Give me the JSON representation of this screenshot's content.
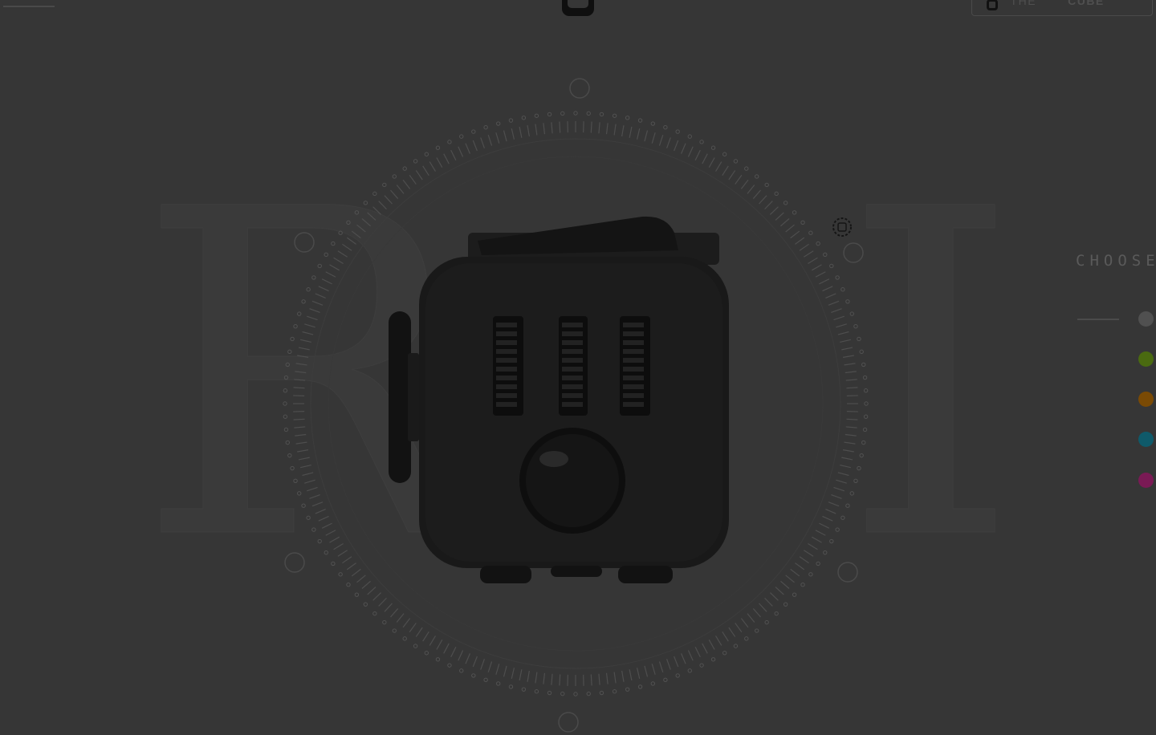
{
  "header": {
    "buy_prefix": "BUY THE",
    "buy_strong": "FIDGET CUBE"
  },
  "background_letters": [
    "R",
    "I"
  ],
  "colors": {
    "page_bg": "#363636",
    "cube_body": "#171717"
  },
  "color_picker": {
    "title": "CHOOSE C",
    "swatches": [
      {
        "name": "graphite",
        "color": "#505050"
      },
      {
        "name": "green",
        "color": "#4a6a10"
      },
      {
        "name": "orange",
        "color": "#7a4a04"
      },
      {
        "name": "aqua",
        "color": "#0f5a6a"
      },
      {
        "name": "pink",
        "color": "#7a1a55"
      }
    ]
  }
}
